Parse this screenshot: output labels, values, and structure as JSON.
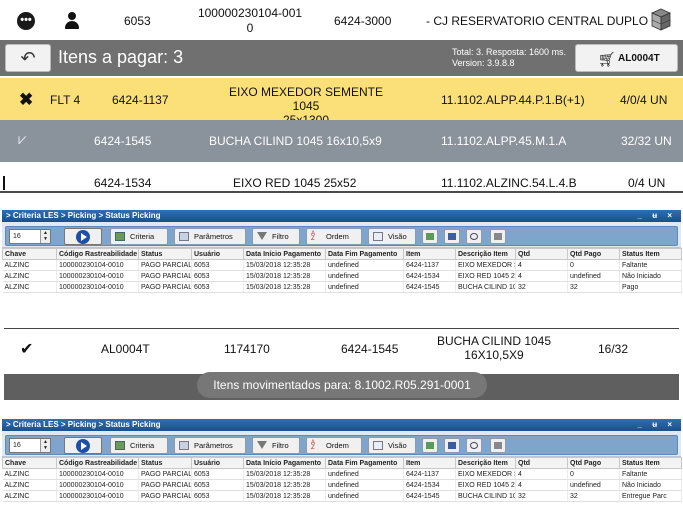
{
  "picking_panel": {
    "header": {
      "menu_icon": "ellipsis-icon",
      "user_icon": "user-icon",
      "code": "6053",
      "rastreabilidade_line1": "100000230104-001",
      "rastreabilidade_line2": "0",
      "item": "6424-3000",
      "location": "- CJ RESERVATORIO CENTRAL DUPLO",
      "box_icon": "boxes-icon"
    },
    "bar": {
      "back_icon": "undo-arrow-icon",
      "title": "Itens a pagar: 3",
      "info_line1": "Total: 3. Resposta: 1600 ms.",
      "info_line2": "Version: 3.9.8.8",
      "cart_icon": "cart-icon",
      "cart_label": "AL0004T"
    },
    "rows": [
      {
        "status_icon": "close-icon",
        "prefix": "FLT 4",
        "item": "6424-1137",
        "desc_line1": "EIXO MEXEDOR SEMENTE 1045",
        "desc_line2": "25x1300",
        "location": "11.1102.ALPP.44.P.1.B(+1)",
        "qty": "4/0/4 UN"
      },
      {
        "status_icon": "double-check-icon",
        "item": "6424-1545",
        "desc": "BUCHA CILIND 1045 16x10,5x9",
        "location": "11.1102.ALPP.45.M.1.A",
        "qty": "32/32 UN"
      },
      {
        "item": "6424-1534",
        "desc": "EIXO RED 1045 25x52",
        "location": "11.1102.ALZINC.54.L.4.B",
        "qty": "0/4 UN"
      }
    ]
  },
  "criteria_window_1": {
    "title": "> Criteria LES > Picking > Status Picking",
    "window_controls": "_ ʉ ×",
    "page": "16",
    "toolbar": {
      "criteria": "Criteria",
      "parametros": "Parâmetros",
      "filtro": "Filtro",
      "ordem": "Ordem",
      "visao": "Visão"
    },
    "columns": [
      "Chave",
      "Código Rastreabilidade",
      "Status",
      "Usuário",
      "Data Início Pagamento",
      "Data Fim Pagamento",
      "Item",
      "Descrição Item",
      "Qtd",
      "Qtd Pago",
      "Status Item"
    ],
    "rows": [
      [
        "ALZINC",
        "100000230104-0010",
        "PAGO PARCIAL",
        "6053",
        "15/03/2018 12:35:28",
        "undefined",
        "6424-1137",
        "EIXO MEXEDOR S",
        "4",
        "0",
        "Faltante"
      ],
      [
        "ALZINC",
        "100000230104-0010",
        "PAGO PARCIAL",
        "6053",
        "15/03/2018 12:35:28",
        "undefined",
        "6424-1534",
        "EIXO RED 1045 2",
        "4",
        "undefined",
        "Não Iniciado"
      ],
      [
        "ALZINC",
        "100000230104-0010",
        "PAGO PARCIAL",
        "6053",
        "15/03/2018 12:35:28",
        "undefined",
        "6424-1545",
        "BUCHA CILIND 10",
        "32",
        "32",
        "Pago"
      ]
    ]
  },
  "confirmation": {
    "check_icon": "check-icon",
    "cart": "AL0004T",
    "number": "1174170",
    "item": "6424-1545",
    "desc_line1": "BUCHA CILIND 1045",
    "desc_line2": "16X10,5X9",
    "qty": "16/32",
    "toast": "Itens movimentados para: 8.1002.R05.291-0001"
  },
  "criteria_window_2": {
    "title": "> Criteria LES > Picking > Status Picking",
    "window_controls": "_ ʉ ×",
    "page": "16",
    "toolbar": {
      "criteria": "Criteria",
      "parametros": "Parâmetros",
      "filtro": "Filtro",
      "ordem": "Ordem",
      "visao": "Visão"
    },
    "columns": [
      "Chave",
      "Código Rastreabilidade",
      "Status",
      "Usuário",
      "Data Início Pagamento",
      "Data Fim Pagamento",
      "Item",
      "Descrição Item",
      "Qtd",
      "Qtd Pago",
      "Status Item"
    ],
    "rows": [
      [
        "ALZINC",
        "100000230104-0010",
        "PAGO PARCIAL",
        "6053",
        "15/03/2018 12:35:28",
        "undefined",
        "6424-1137",
        "EIXO MEXEDOR S",
        "4",
        "0",
        "Faltante"
      ],
      [
        "ALZINC",
        "100000230104-0010",
        "PAGO PARCIAL",
        "6053",
        "15/03/2018 12:35:28",
        "undefined",
        "6424-1534",
        "EIXO RED 1045 2",
        "4",
        "undefined",
        "Não Iniciado"
      ],
      [
        "ALZINC",
        "100000230104-0010",
        "PAGO PARCIAL",
        "6053",
        "15/03/2018 12:35:28",
        "undefined",
        "6424-1545",
        "BUCHA CILIND 10",
        "32",
        "32",
        "Entregue Parc"
      ]
    ]
  },
  "colors": {
    "highlight_row": "#fbe07a",
    "done_row": "#8a929c",
    "bar": "#707070",
    "window_title": "#1b4f8a"
  }
}
